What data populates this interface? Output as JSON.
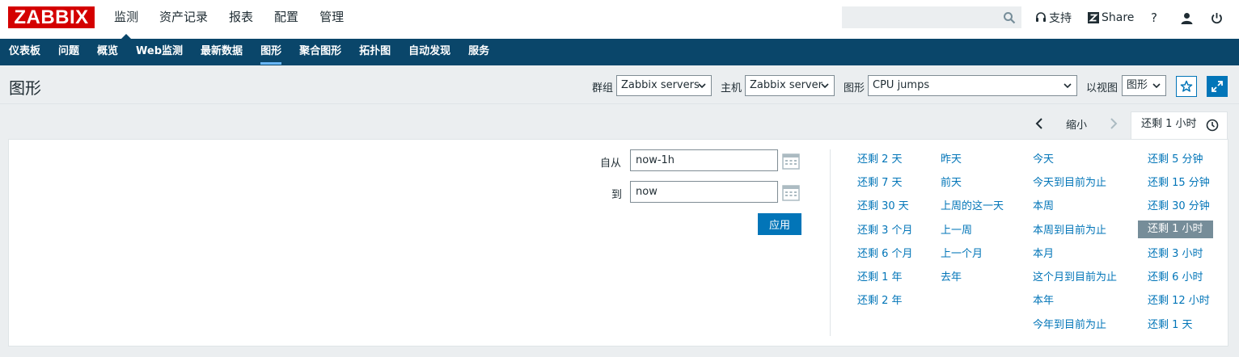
{
  "brand": {
    "logo_text": "ZABBIX",
    "logo_color": "#d40000"
  },
  "top_menu": [
    {
      "label": "监测",
      "active": true
    },
    {
      "label": "资产记录"
    },
    {
      "label": "报表"
    },
    {
      "label": "配置"
    },
    {
      "label": "管理"
    }
  ],
  "search": {
    "value": "",
    "placeholder": ""
  },
  "top_tools": {
    "support_label": "支持",
    "share_label": "Share",
    "help_label": "?"
  },
  "nav": [
    {
      "label": "仪表板"
    },
    {
      "label": "问题"
    },
    {
      "label": "概览"
    },
    {
      "label": "Web监测"
    },
    {
      "label": "最新数据"
    },
    {
      "label": "图形",
      "active": true
    },
    {
      "label": "聚合图形"
    },
    {
      "label": "拓扑图"
    },
    {
      "label": "自动发现"
    },
    {
      "label": "服务"
    }
  ],
  "header": {
    "title": "图形",
    "group_label": "群组",
    "group_value": "Zabbix servers",
    "host_label": "主机",
    "host_value": "Zabbix server",
    "graph_label": "图形",
    "graph_value": "CPU jumps",
    "view_label": "以视图",
    "view_value": "图形"
  },
  "timeline": {
    "zoom_out_label": "缩小",
    "tab_label": "还剩 1 小时"
  },
  "time_form": {
    "from_label": "自从",
    "from_value": "now-1h",
    "to_label": "到",
    "to_value": "now",
    "apply_label": "应用"
  },
  "quick_ranges": {
    "col1": [
      "还剩 2 天",
      "还剩 7 天",
      "还剩 30 天",
      "还剩 3 个月",
      "还剩 6 个月",
      "还剩 1 年",
      "还剩 2 年"
    ],
    "col2": [
      "昨天",
      "前天",
      "上周的这一天",
      "上一周",
      "上一个月",
      "去年"
    ],
    "col3": [
      "今天",
      "今天到目前为止",
      "本周",
      "本周到目前为止",
      "本月",
      "这个月到目前为止",
      "本年",
      "今年到目前为止"
    ],
    "col4": [
      "还剩 5 分钟",
      "还剩 15 分钟",
      "还剩 30 分钟",
      "还剩 1 小时",
      "还剩 3 小时",
      "还剩 6 小时",
      "还剩 12 小时",
      "还剩 1 天"
    ],
    "selected": "还剩 1 小时"
  },
  "colors": {
    "nav_bg": "#0a466a",
    "link": "#0275b8",
    "selected_bg": "#768d99",
    "page_bg": "#ebeef0"
  }
}
